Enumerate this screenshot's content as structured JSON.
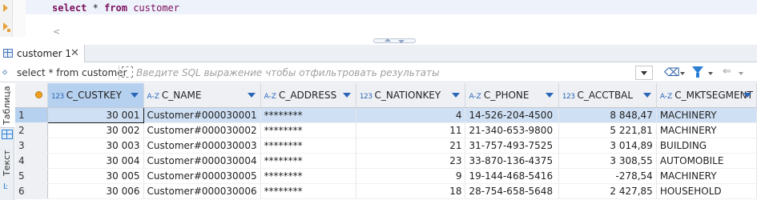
{
  "editor": {
    "sql_keyword_select": "select",
    "sql_star": "*",
    "sql_keyword_from": "from",
    "sql_table": "customer",
    "scroll_left_glyph": "<"
  },
  "result_tab": {
    "label": "customer 1",
    "close_glyph": "✕",
    "icon": "table-grid-icon"
  },
  "filter_bar": {
    "query_prefix_icon": "sql-query-icon",
    "query_text": "select * from customer",
    "filter_placeholder": "Введите SQL выражение чтобы отфильтровать результаты",
    "eraser_glyph": "⌫",
    "back_glyph": "⇐",
    "more_glyph": "⇒"
  },
  "side_panel": {
    "table_tab_label": "Таблица",
    "text_tab_label": "Текст",
    "text_icon": "Ŀ"
  },
  "grid": {
    "columns": [
      {
        "name": "C_CUSTKEY",
        "type_icon": "123",
        "type": "numeric",
        "active": true
      },
      {
        "name": "C_NAME",
        "type_icon": "A-Z",
        "type": "text",
        "active": false
      },
      {
        "name": "C_ADDRESS",
        "type_icon": "A-Z",
        "type": "text",
        "active": false
      },
      {
        "name": "C_NATIONKEY",
        "type_icon": "123",
        "type": "numeric",
        "active": false
      },
      {
        "name": "C_PHONE",
        "type_icon": "A-Z",
        "type": "text",
        "active": false
      },
      {
        "name": "C_ACCTBAL",
        "type_icon": "123",
        "type": "numeric",
        "active": false
      },
      {
        "name": "C_MKTSEGMENT",
        "type_icon": "A-Z",
        "type": "text",
        "active": false
      }
    ],
    "rows": [
      {
        "n": "1",
        "custkey": "30 001",
        "name": "Customer#000030001",
        "address": "********",
        "nationkey": "4",
        "phone": "14-526-204-4500",
        "acctbal": "8 848,47",
        "mktsegment": "MACHINERY"
      },
      {
        "n": "2",
        "custkey": "30 002",
        "name": "Customer#000030002",
        "address": "********",
        "nationkey": "11",
        "phone": "21-340-653-9800",
        "acctbal": "5 221,81",
        "mktsegment": "MACHINERY"
      },
      {
        "n": "3",
        "custkey": "30 003",
        "name": "Customer#000030003",
        "address": "********",
        "nationkey": "21",
        "phone": "31-757-493-7525",
        "acctbal": "3 014,89",
        "mktsegment": "BUILDING"
      },
      {
        "n": "4",
        "custkey": "30 004",
        "name": "Customer#000030004",
        "address": "********",
        "nationkey": "23",
        "phone": "33-870-136-4375",
        "acctbal": "3 308,55",
        "mktsegment": "AUTOMOBILE"
      },
      {
        "n": "5",
        "custkey": "30 005",
        "name": "Customer#000030005",
        "address": "********",
        "nationkey": "9",
        "phone": "19-144-468-5416",
        "acctbal": "-278,54",
        "mktsegment": "MACHINERY"
      },
      {
        "n": "6",
        "custkey": "30 006",
        "name": "Customer#000030006",
        "address": "********",
        "nationkey": "18",
        "phone": "28-754-658-5648",
        "acctbal": "2 427,85",
        "mktsegment": "HOUSEHOLD"
      }
    ]
  },
  "colors": {
    "keyword": "#7a0e5c",
    "selection": "#cfe0f4",
    "active_header": "#b6d1ef",
    "accent": "#2a66b8"
  }
}
